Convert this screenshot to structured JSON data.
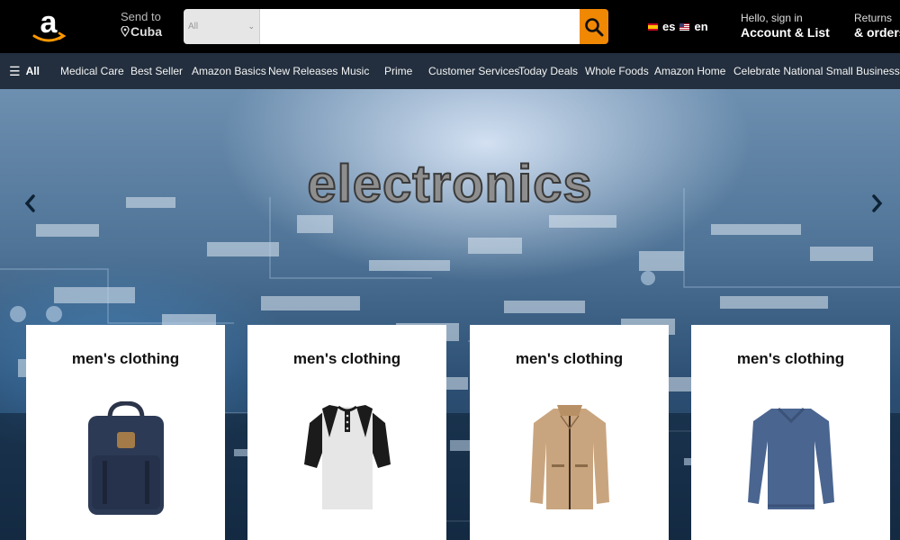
{
  "header": {
    "send_to_label": "Send to",
    "send_to_location": "Cuba",
    "search": {
      "category": "All",
      "value": "",
      "placeholder": ""
    },
    "languages": [
      "es",
      "en"
    ],
    "account_greeting": "Hello, sign in",
    "account_label": "Account & List",
    "returns_label": "Returns",
    "orders_label": "& orders"
  },
  "nav": {
    "all_label": "All",
    "items": [
      "Medical Care",
      "Best Seller",
      "Amazon Basics",
      "New Releases",
      "Music",
      "Prime",
      "Customer Services",
      "Today Deals",
      "Whole Foods",
      "Amazon Home",
      "Celebrate National Small Business Month"
    ]
  },
  "hero": {
    "title": "electronics"
  },
  "cards": [
    {
      "title": "men's clothing",
      "image": "backpack"
    },
    {
      "title": "men's clothing",
      "image": "raglan-henley-shirt"
    },
    {
      "title": "men's clothing",
      "image": "khaki-jacket"
    },
    {
      "title": "men's clothing",
      "image": "blue-v-neck-sweater"
    }
  ],
  "colors": {
    "header_bg": "#000000",
    "nav_bg": "#232f3e",
    "search_button": "#f08804",
    "page_bg": "#eaeded"
  }
}
